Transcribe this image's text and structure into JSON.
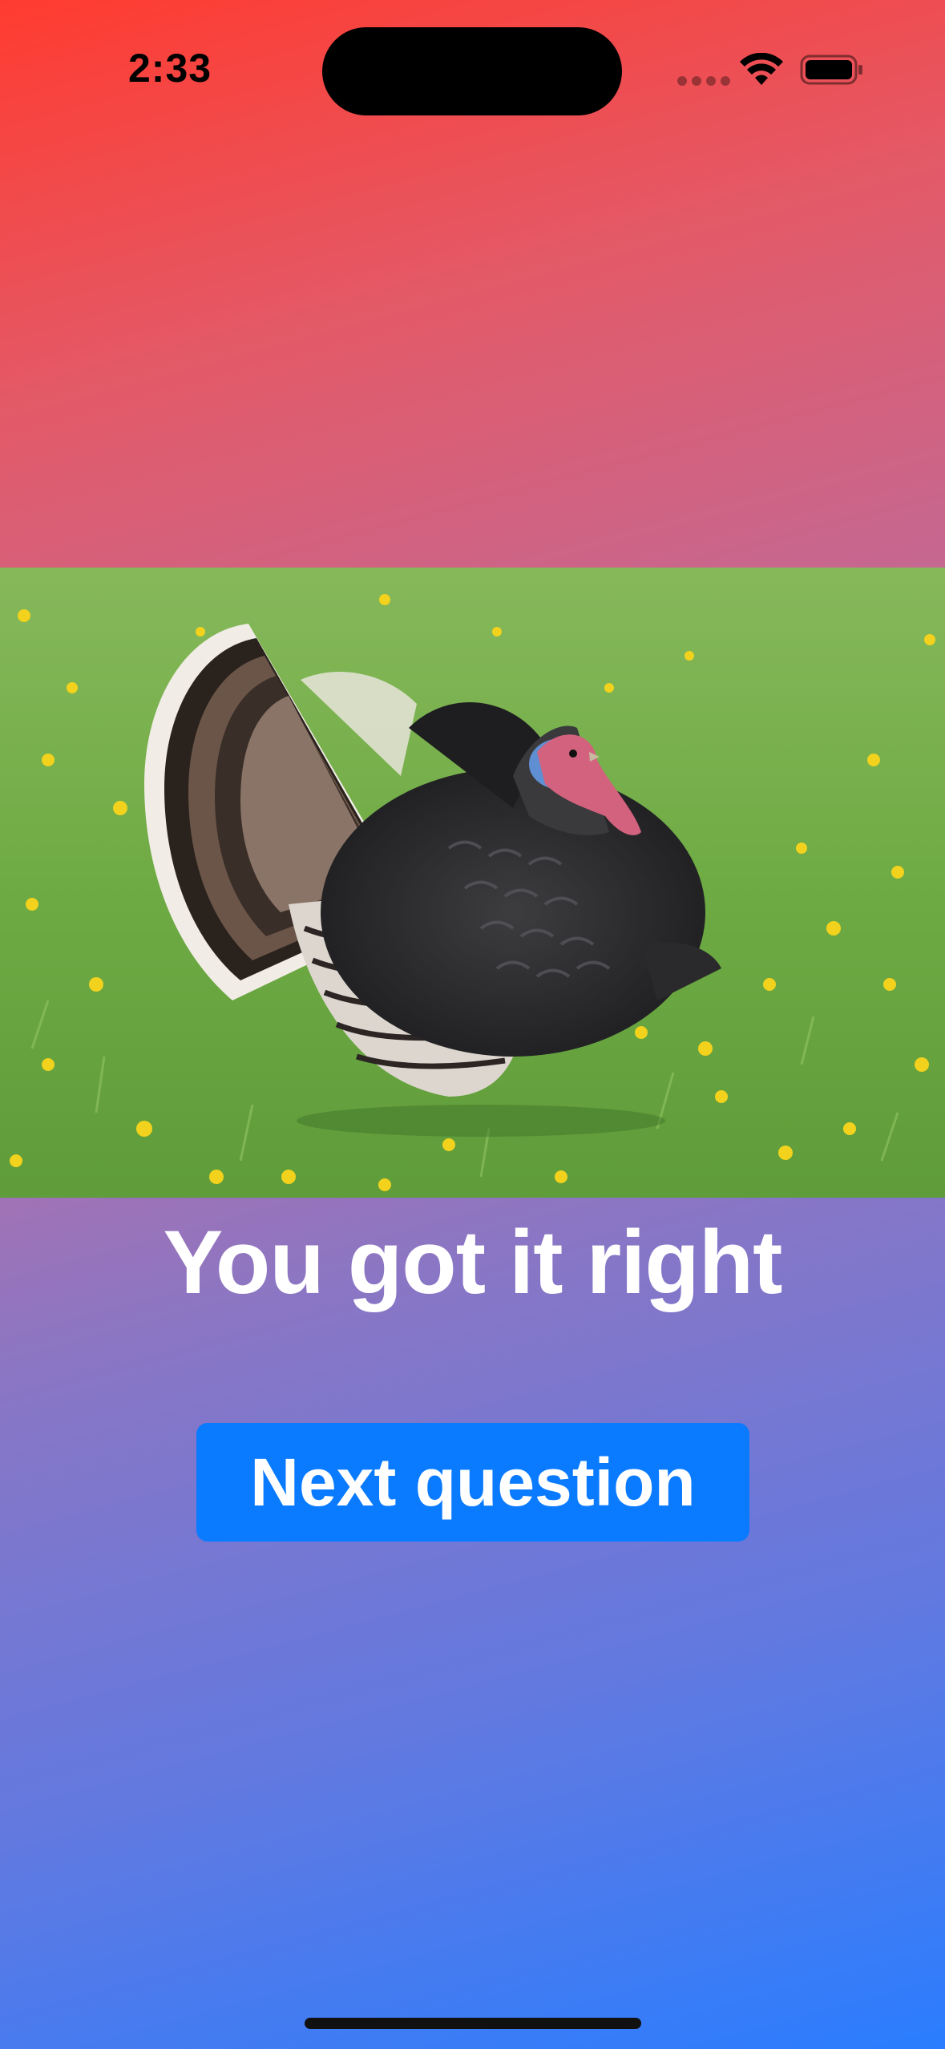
{
  "status_bar": {
    "time": "2:33",
    "icons": [
      "signal-icon",
      "wifi-icon",
      "battery-icon"
    ]
  },
  "photo": {
    "subject": "turkey"
  },
  "result": {
    "title": "You got it right"
  },
  "actions": {
    "next_label": "Next question"
  },
  "colors": {
    "gradient_top": "#ff3b30",
    "gradient_bottom": "#2a7dff",
    "button": "#0a7bff",
    "text": "#ffffff"
  }
}
